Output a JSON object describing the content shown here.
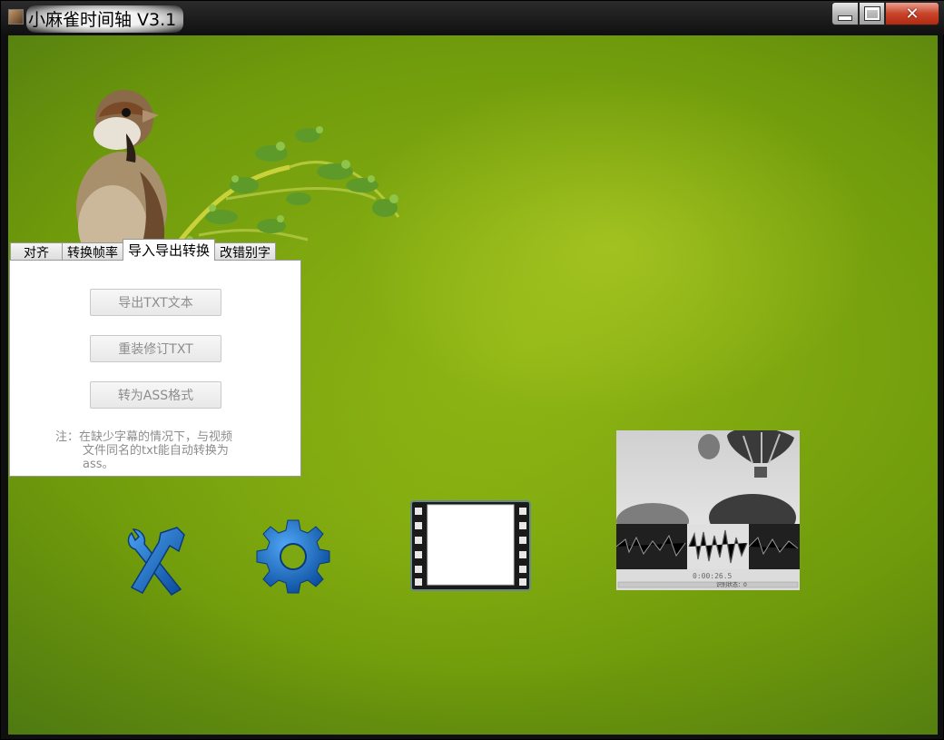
{
  "window": {
    "title": "小麻雀时间轴 V3.1",
    "controls": {
      "minimize": "minimize-icon",
      "maximize": "maximize-icon",
      "close": "close-icon"
    }
  },
  "tabs": [
    {
      "label": "对齐",
      "active": false
    },
    {
      "label": "转换帧率",
      "active": false
    },
    {
      "label": "导入导出转换",
      "active": true
    },
    {
      "label": "改错别字",
      "active": false
    }
  ],
  "panel": {
    "buttons": {
      "export_txt": "导出TXT文本",
      "reload_txt": "重装修订TXT",
      "to_ass": "转为ASS格式"
    },
    "note_line1": "注：在缺少字幕的情况下，与视频",
    "note_line2": "文件同名的txt能自动转换为",
    "note_line3": "ass。"
  },
  "preview": {
    "time_readout": "0:00:26.5",
    "status_readout": "识别状态：0"
  },
  "colors": {
    "background_green": "#7ea811",
    "close_red": "#c8442a",
    "disabled_text": "#8d8d8d",
    "icon_blue": "#1c6fc4"
  },
  "icons": [
    "sparrow-decoration",
    "tools-icon",
    "gear-icon",
    "film-icon",
    "waveform-preview-icon"
  ]
}
